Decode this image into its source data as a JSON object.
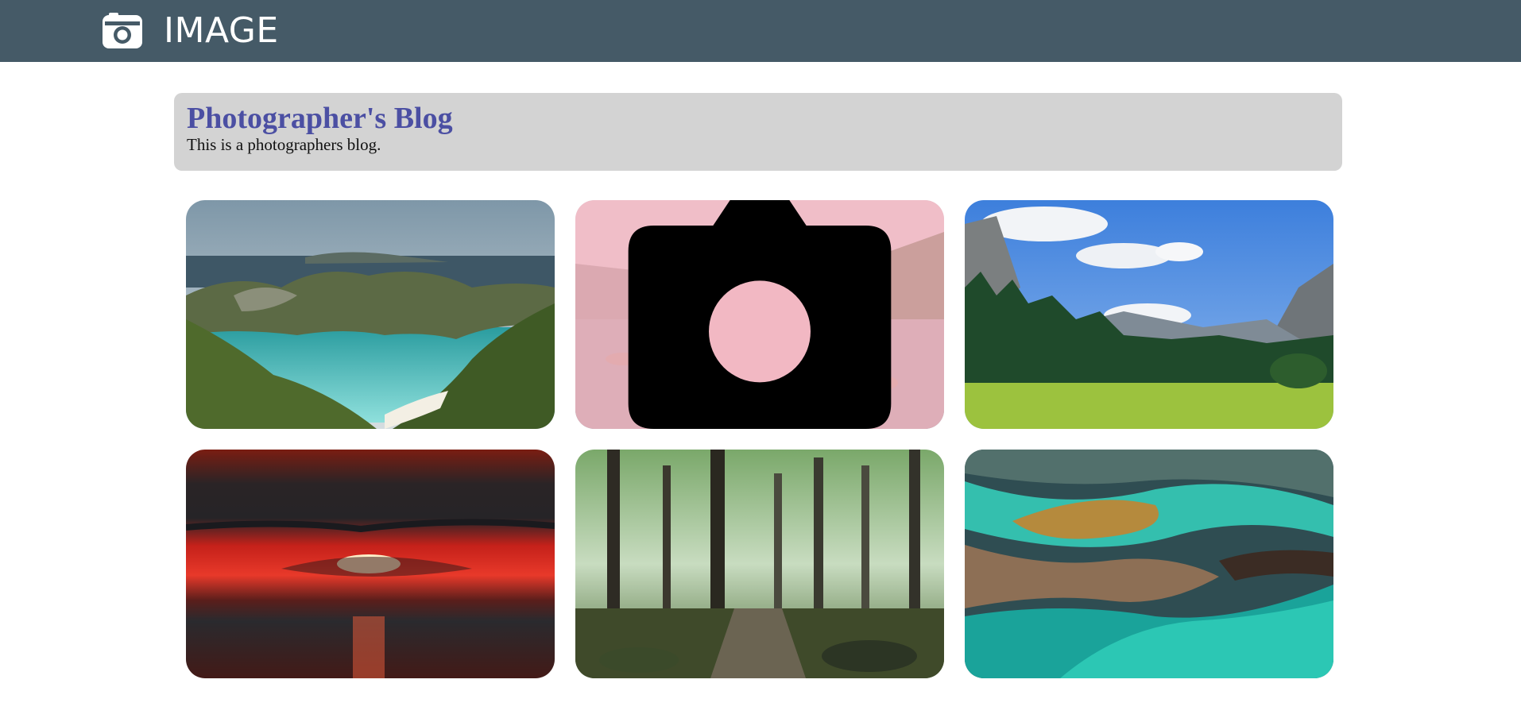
{
  "header": {
    "brand_text": "IMAGE",
    "brand_icon": "camera-icon",
    "background_color": "#455a67"
  },
  "hero": {
    "title": "Photographer's Blog",
    "subtitle": "This is a photographers blog.",
    "background_color": "#d3d3d3",
    "title_color": "#4b4fa3"
  },
  "gallery": {
    "hover_overlay_color": "#ffb6c1",
    "hover_overlay_icon": "camera-icon",
    "photos": [
      {
        "subject": "tropical-bay"
      },
      {
        "subject": "mountain-lake",
        "hovered": true
      },
      {
        "subject": "mountain-meadow"
      },
      {
        "subject": "red-sunset-over-sea"
      },
      {
        "subject": "misty-forest"
      },
      {
        "subject": "aerial-turquoise-river"
      }
    ]
  }
}
